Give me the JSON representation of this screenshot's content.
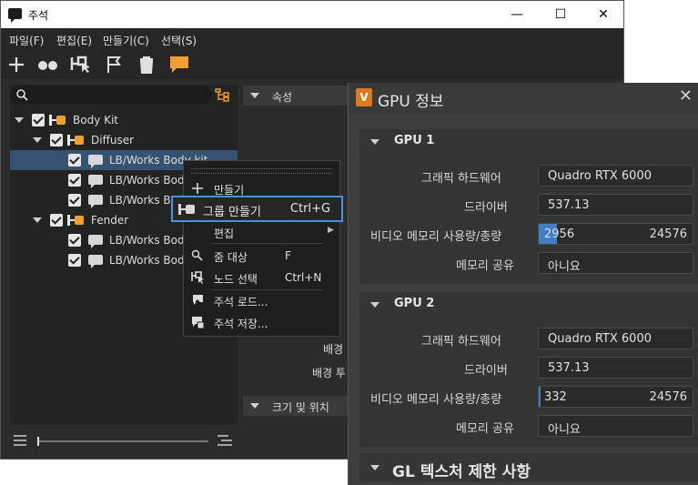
{
  "window": {
    "title": "주석",
    "minimize": "—",
    "maximize": "☐",
    "close": "✕"
  },
  "menu": [
    "파일(F)",
    "편집(E)",
    "만들기(C)",
    "선택(S)"
  ],
  "toolbar_icons": [
    "plus-icon",
    "dots-icon",
    "select-nodes-icon",
    "flag-icon",
    "trash-icon",
    "comment-icon"
  ],
  "tree": [
    {
      "label": "Body Kit",
      "type": "group",
      "level": 0
    },
    {
      "label": "Diffuser",
      "type": "group",
      "level": 1
    },
    {
      "label": "LB/Works Body kit",
      "type": "note",
      "level": 2,
      "selected": true
    },
    {
      "label": "LB/Works Body",
      "type": "note",
      "level": 2
    },
    {
      "label": "LB/Works Body",
      "type": "note",
      "level": 2
    },
    {
      "label": "Fender",
      "type": "group",
      "level": 1
    },
    {
      "label": "LB/Works Body",
      "type": "note",
      "level": 2
    },
    {
      "label": "LB/Works Body",
      "type": "note",
      "level": 2
    }
  ],
  "properties": {
    "header_attrs": "속성",
    "header_size": "크기 및 위치",
    "label_bg": "배경",
    "label_bg_transparency": "배경 투"
  },
  "context_menu": {
    "create": "만들기",
    "make_group": "그룹 만들기",
    "make_group_shortcut": "Ctrl+G",
    "edit": "편집",
    "zoom_target": "줌 대상",
    "zoom_target_shortcut": "F",
    "select_nodes": "노드 선택",
    "select_nodes_shortcut": "Ctrl+N",
    "load_notes": "주석 로드...",
    "save_notes": "주석 저장..."
  },
  "gpu_dialog": {
    "title": "GPU 정보",
    "logo": "V",
    "gpus": [
      {
        "name": "GPU 1",
        "graphics_hw_label": "그래픽 하드웨어",
        "graphics_hw": "Quadro RTX 6000",
        "driver_label": "드라이버",
        "driver": "537.13",
        "memory_label": "비디오 메모리 사용량/총량",
        "mem_used": "2956",
        "mem_total": "24576",
        "mem_fraction": 0.12,
        "shared_label": "메모리 공유",
        "shared": "아니요"
      },
      {
        "name": "GPU 2",
        "graphics_hw_label": "그래픽 하드웨어",
        "graphics_hw": "Quadro RTX 6000",
        "driver_label": "드라이버",
        "driver": "537.13",
        "memory_label": "비디오 메모리 사용량/총량",
        "mem_used": "332",
        "mem_total": "24576",
        "mem_fraction": 0.014,
        "shared_label": "메모리 공유",
        "shared": "아니요"
      }
    ],
    "gl_section": "GL 텍스처 제한 사항"
  }
}
